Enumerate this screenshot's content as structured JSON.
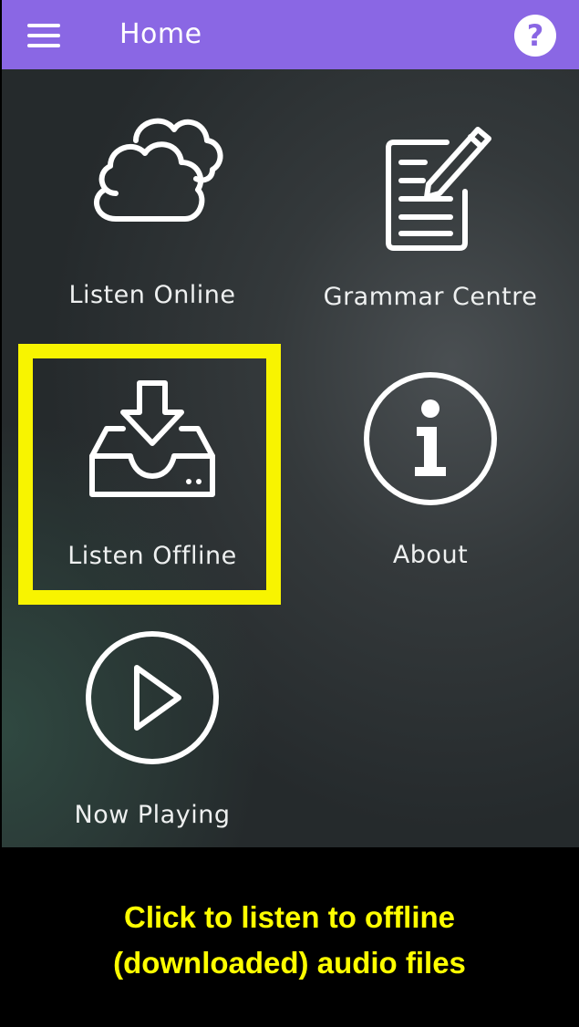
{
  "app_bar": {
    "title": "Home",
    "menu_icon": "hamburger-menu-icon",
    "help_icon": "question-mark-icon",
    "help_glyph": "?",
    "color": "#8a67e4"
  },
  "tiles": [
    {
      "label": "Listen Online",
      "icon": "clouds-icon"
    },
    {
      "label": "Grammar Centre",
      "icon": "document-pencil-icon"
    },
    {
      "label": "Listen Offline",
      "icon": "download-tray-icon",
      "highlighted": true
    },
    {
      "label": "About",
      "icon": "info-circle-icon"
    },
    {
      "label": "Now Playing",
      "icon": "play-circle-icon"
    }
  ],
  "highlight_color": "#f8f400",
  "caption": {
    "line1": "Click to listen to offline",
    "line2": "(downloaded) audio files",
    "color": "#ffff00"
  }
}
